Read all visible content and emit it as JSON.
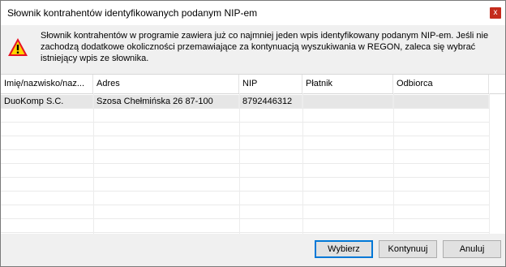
{
  "window": {
    "title": "Słownik kontrahentów identyfikowanych podanym NIP-em",
    "close_label": "x"
  },
  "warning": {
    "icon": "warning-triangle-icon",
    "message": "Słownik kontrahentów w programie zawiera już co najmniej jeden wpis identyfikowany podanym NIP-em. Jeśli nie zachodzą dodatkowe okoliczności przemawiające za kontynuacją wyszukiwania w REGON, zaleca się wybrać istniejący wpis ze słownika."
  },
  "table": {
    "columns": [
      "Imię/nazwisko/naz...",
      "Adres",
      "NIP",
      "Płatnik",
      "Odbiorca"
    ],
    "rows": [
      [
        "DuoKomp S.C.",
        "Szosa Chełmińska 26 87-100",
        "8792446312",
        "",
        ""
      ]
    ]
  },
  "buttons": {
    "select": "Wybierz",
    "continue": "Kontynuuj",
    "cancel": "Anuluj"
  },
  "colors": {
    "close": "#c42b1c",
    "default_button_border": "#0078d7",
    "warning_fill": "#ffd400",
    "warning_outline": "#e81123"
  }
}
